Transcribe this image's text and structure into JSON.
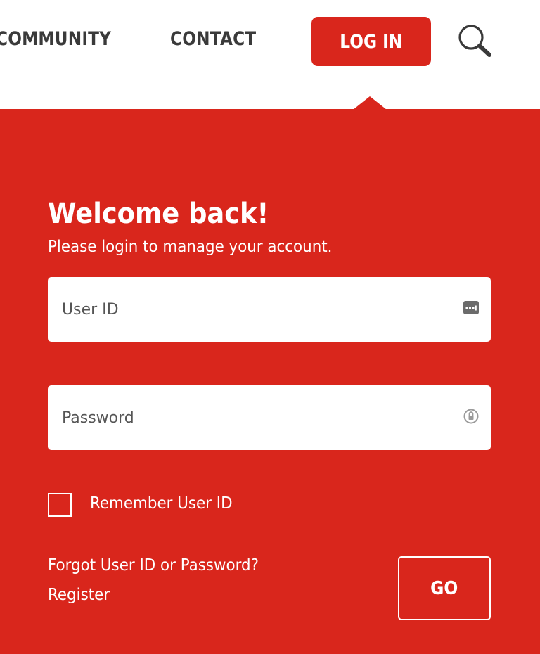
{
  "nav": {
    "community_label": "COMMUNITY",
    "contact_label": "CONTACT",
    "login_label": "LOG IN"
  },
  "login_form": {
    "title": "Welcome back!",
    "subtitle": "Please login to manage your account.",
    "user_id": {
      "placeholder": "User ID",
      "value": ""
    },
    "password": {
      "placeholder": "Password",
      "value": ""
    },
    "remember_label": "Remember User ID",
    "remember_checked": false,
    "forgot_link": "Forgot User ID or Password?",
    "register_link": "Register",
    "go_label": "GO"
  },
  "icons": {
    "search": "search-icon",
    "user_field": "password-manager-icon",
    "password_field": "password-reveal-icon"
  },
  "colors": {
    "brand_red": "#d9261c",
    "nav_text": "#3a3a3a",
    "white": "#ffffff"
  }
}
